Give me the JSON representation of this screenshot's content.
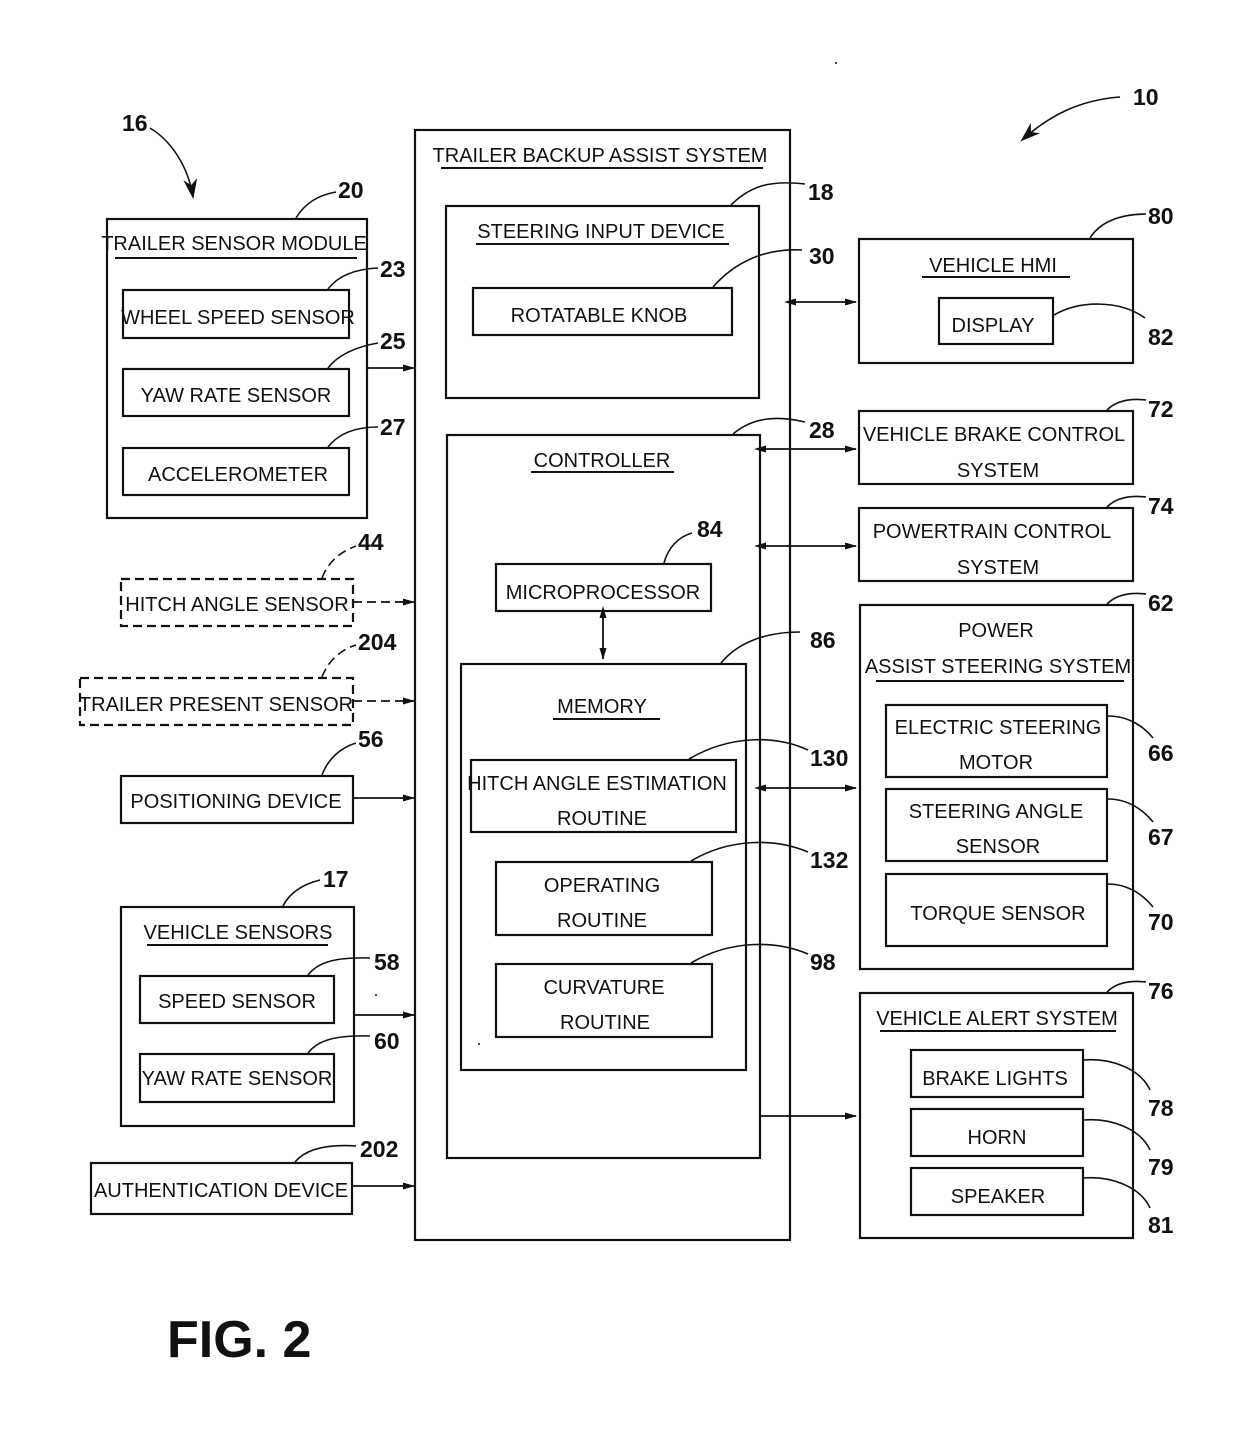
{
  "figure_label": "FIG. 2",
  "refs": {
    "system": "10",
    "sensor_group": "16",
    "trailer_sensor_module": "20",
    "wheel_speed_sensor": "23",
    "yaw_rate_sensor_trailer": "25",
    "accelerometer": "27",
    "hitch_angle_sensor": "44",
    "trailer_present_sensor": "204",
    "positioning_device": "56",
    "vehicle_sensors": "17",
    "speed_sensor": "58",
    "yaw_rate_sensor_vehicle": "60",
    "authentication_device": "202",
    "steering_input_device": "18",
    "rotatable_knob": "30",
    "controller": "28",
    "microprocessor": "84",
    "memory": "86",
    "hitch_angle_estimation_routine": "130",
    "operating_routine": "132",
    "curvature_routine": "98",
    "vehicle_hmi": "80",
    "display": "82",
    "vehicle_brake_control_system": "72",
    "powertrain_control_system": "74",
    "power_assist_steering_system": "62",
    "electric_steering_motor": "66",
    "steering_angle_sensor": "67",
    "torque_sensor": "70",
    "vehicle_alert_system": "76",
    "brake_lights": "78",
    "horn": "79",
    "speaker": "81"
  },
  "left": {
    "trailer_sensor_module": {
      "title": "TRAILER SENSOR MODULE",
      "items": [
        "WHEEL SPEED SENSOR",
        "YAW RATE SENSOR",
        "ACCELEROMETER"
      ]
    },
    "hitch_angle_sensor": "HITCH ANGLE SENSOR",
    "trailer_present_sensor": "TRAILER  PRESENT SENSOR",
    "positioning_device": "POSITIONING DEVICE",
    "vehicle_sensors": {
      "title": "VEHICLE SENSORS",
      "items": [
        "SPEED SENSOR",
        "YAW RATE SENSOR"
      ]
    },
    "authentication_device": "AUTHENTICATION DEVICE"
  },
  "center": {
    "title": "TRAILER BACKUP ASSIST SYSTEM",
    "steering_input_device": {
      "title": "STEERING INPUT DEVICE",
      "knob": "ROTATABLE KNOB"
    },
    "controller": {
      "title": "CONTROLLER",
      "microprocessor": "MICROPROCESSOR",
      "memory": {
        "title": "MEMORY",
        "routines": [
          {
            "line1": "HITCH ANGLE ESTIMATION",
            "line2": "ROUTINE"
          },
          {
            "line1": "OPERATING",
            "line2": "ROUTINE"
          },
          {
            "line1": "CURVATURE",
            "line2": "ROUTINE"
          }
        ]
      }
    }
  },
  "right": {
    "vehicle_hmi": {
      "title": "VEHICLE HMI",
      "display": "DISPLAY"
    },
    "brake_control": {
      "line1": "VEHICLE BRAKE CONTROL",
      "line2": "SYSTEM"
    },
    "powertrain_control": {
      "line1": "POWERTRAIN CONTROL",
      "line2": "SYSTEM"
    },
    "power_assist_steering": {
      "line1": "POWER",
      "line2": "ASSIST STEERING SYSTEM",
      "items": [
        {
          "line1": "ELECTRIC STEERING",
          "line2": "MOTOR"
        },
        {
          "line1": "STEERING ANGLE",
          "line2": "SENSOR"
        },
        {
          "line1": "TORQUE SENSOR",
          "line2": ""
        }
      ]
    },
    "vehicle_alert_system": {
      "title": "VEHICLE ALERT SYSTEM",
      "items": [
        "BRAKE LIGHTS",
        "HORN",
        "SPEAKER"
      ]
    }
  }
}
